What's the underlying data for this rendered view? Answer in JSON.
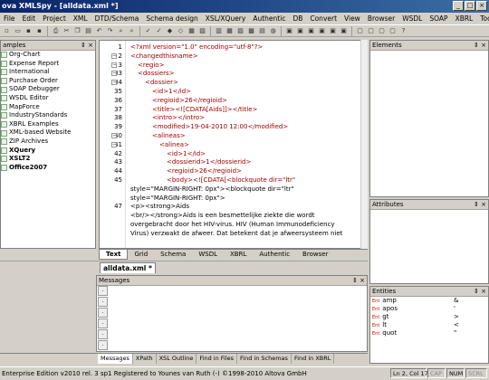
{
  "window": {
    "title": "ova XMLSpy - [alldata.xml *]"
  },
  "menu": [
    "File",
    "Edit",
    "Project",
    "XML",
    "DTD/Schema",
    "Schema design",
    "XSL/XQuery",
    "Authentic",
    "DB",
    "Convert",
    "View",
    "Browser",
    "WSDL",
    "SOAP",
    "XBRL",
    "Tools",
    "Window",
    "Help"
  ],
  "project": {
    "header": "amples",
    "items": [
      {
        "label": "Org-Chart",
        "bold": false
      },
      {
        "label": "Expense Report",
        "bold": false
      },
      {
        "label": "International",
        "bold": false
      },
      {
        "label": "Purchase Order",
        "bold": false
      },
      {
        "label": "SOAP Debugger",
        "bold": false
      },
      {
        "label": "WSDL Editor",
        "bold": false
      },
      {
        "label": "MapForce",
        "bold": false
      },
      {
        "label": "IndustryStandards",
        "bold": false
      },
      {
        "label": "XBRL Examples",
        "bold": false
      },
      {
        "label": "XML-based Website",
        "bold": false
      },
      {
        "label": "ZIP Archives",
        "bold": false
      },
      {
        "label": "XQuery",
        "bold": true
      },
      {
        "label": "XSLT2",
        "bold": true
      },
      {
        "label": "Office2007",
        "bold": true
      }
    ]
  },
  "editor": {
    "lines": [
      {
        "num": "1",
        "text": "<?xml version=\"1.0\" encoding=\"utf-8\"?>",
        "cls": "pi",
        "indent": 0
      },
      {
        "num": "2",
        "text": "<changedthisname>",
        "cls": "tag",
        "indent": 0
      },
      {
        "num": "3",
        "text": "<regio>",
        "cls": "tag",
        "indent": 1
      },
      {
        "num": "33",
        "text": "<dossiers>",
        "cls": "tag",
        "indent": 1
      },
      {
        "num": "34",
        "text": "<dossier>",
        "cls": "tag",
        "indent": 2
      },
      {
        "num": "35",
        "text": "<id>1</id>",
        "cls": "tag",
        "indent": 3
      },
      {
        "num": "36",
        "text": "<regioid>26</regioid>",
        "cls": "tag",
        "indent": 3
      },
      {
        "num": "37",
        "text": "<title><![CDATA[Aids]]></title>",
        "cls": "tag",
        "indent": 3
      },
      {
        "num": "38",
        "text": "<intro></intro>",
        "cls": "tag",
        "indent": 3
      },
      {
        "num": "39",
        "text": "<modified>19-04-2010 12:00</modified>",
        "cls": "tag",
        "indent": 3
      },
      {
        "num": "40",
        "text": "<alineas>",
        "cls": "tag",
        "indent": 3
      },
      {
        "num": "41",
        "text": "<alinea>",
        "cls": "tag",
        "indent": 4
      },
      {
        "num": "42",
        "text": "<id>1</id>",
        "cls": "tag",
        "indent": 5
      },
      {
        "num": "43",
        "text": "<dossierid>1</dossierid>",
        "cls": "tag",
        "indent": 5
      },
      {
        "num": "44",
        "text": "<regioid>26</regioid>",
        "cls": "tag",
        "indent": 5
      },
      {
        "num": "45",
        "text": "<body><![CDATA[<blockquote dir=\"ltr\"",
        "cls": "tag",
        "indent": 5
      },
      {
        "num": "",
        "text": "style=\"MARGIN-RIGHT: 0px\"><blockquote dir=\"ltr\"",
        "cls": "txt",
        "indent": 0
      },
      {
        "num": "",
        "text": "style=\"MARGIN-RIGHT: 0px\">",
        "cls": "txt",
        "indent": 0
      },
      {
        "num": "47",
        "text": "<p><strong>Aids",
        "cls": "txt",
        "indent": 0
      },
      {
        "num": "",
        "text": "<br/></strong>Aids is een besmettelijke ziekte die wordt",
        "cls": "txt",
        "indent": 0
      },
      {
        "num": "",
        "text": "overgebracht door het HIV-virus. HIV (Human Immunodeficiency",
        "cls": "txt",
        "indent": 0
      },
      {
        "num": "",
        "text": "Virus) verzwakt de afweer. Dat betekent dat je afweersysteem niet",
        "cls": "txt",
        "indent": 0
      }
    ]
  },
  "viewtabs": [
    "Text",
    "Grid",
    "Schema",
    "WSDL",
    "XBRL",
    "Authentic",
    "Browser"
  ],
  "doctab": "alldata.xml *",
  "messages": {
    "header": "Messages"
  },
  "msgtabs": [
    "Messages",
    "XPath",
    "XSL Outline",
    "Find in Files",
    "Find in Schemas",
    "Find in XBRL"
  ],
  "elements": {
    "header": "Elements"
  },
  "attributes": {
    "header": "Attributes"
  },
  "entities": {
    "header": "Entities",
    "items": [
      {
        "name": "amp",
        "char": "&"
      },
      {
        "name": "apos",
        "char": "'"
      },
      {
        "name": "gt",
        "char": ">"
      },
      {
        "name": "lt",
        "char": "<"
      },
      {
        "name": "quot",
        "char": "\""
      }
    ],
    "icon_label": "Ent"
  },
  "status": {
    "left": "Enterprise Edition v2010 rel. 3 sp1  Registered to Younes van Ruth (-)  ©1998-2010 Altova GmbH",
    "pos": "Ln 2, Col 17",
    "cap": "CAP",
    "num": "NUM",
    "scrl": "SCRL"
  },
  "colors": {
    "titlebar": "#0a246a",
    "tag": "#a00000",
    "chrome": "#d4d0c8"
  }
}
